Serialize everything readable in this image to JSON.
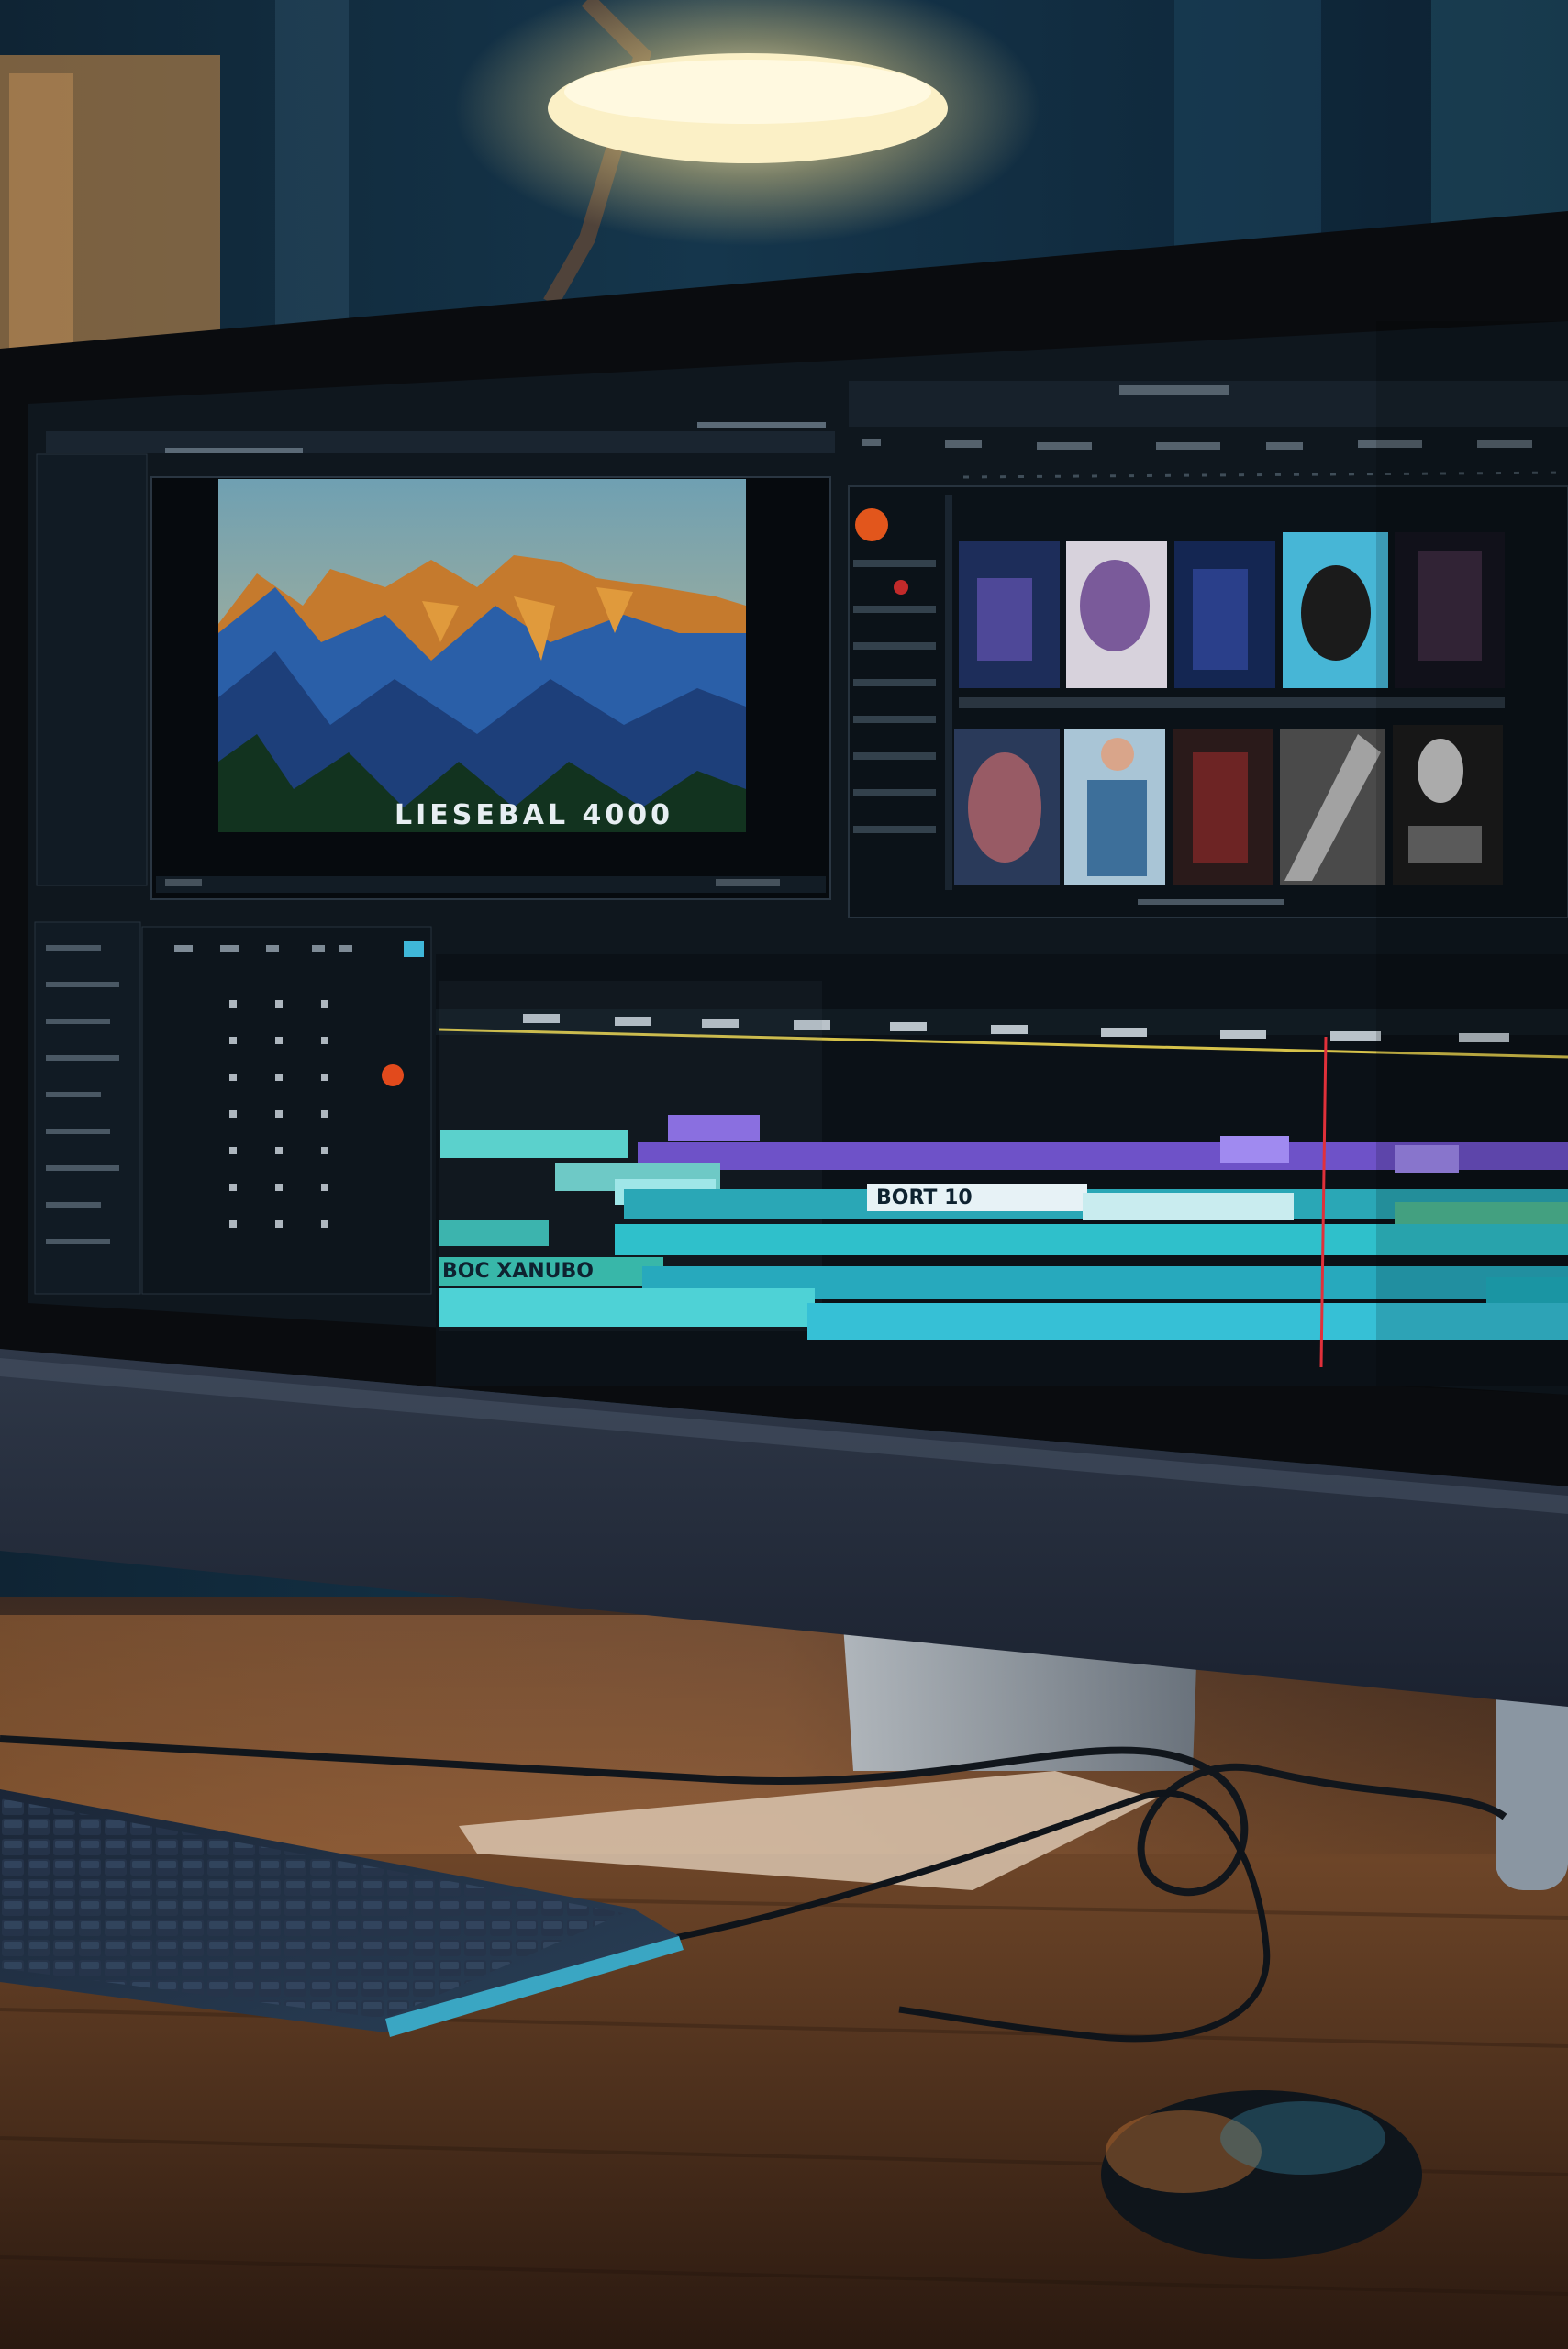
{
  "scene": {
    "description_free": true
  },
  "colors": {
    "room_shadow": "#0d1a27",
    "room_blue": "#163247",
    "lamp_glow": "#f7e6b0",
    "bezel": "#0b0d10",
    "screen_bg": "#111a22",
    "panel_border": "#26323d",
    "track_teal": "#2fb9c2",
    "track_teal_light": "#7fe3e4",
    "track_purple": "#8b6fe0",
    "playhead": "#e0303a",
    "timeline_yellow": "#d6c24a",
    "desk_wood": "#6a4327",
    "desk_wood_dark": "#2a1a12",
    "keyboard": "#1e2a3a",
    "keyboard_edge": "#3a9bb7"
  },
  "viewer": {
    "overlay_text": "LIESEBAL 4000"
  },
  "icons": {
    "record_dot": "record-dot-icon",
    "media_thumbnail": "thumbnail-icon"
  },
  "timeline": {
    "clip_labels": [
      "BORT 10",
      "BOC XANUBO"
    ]
  }
}
